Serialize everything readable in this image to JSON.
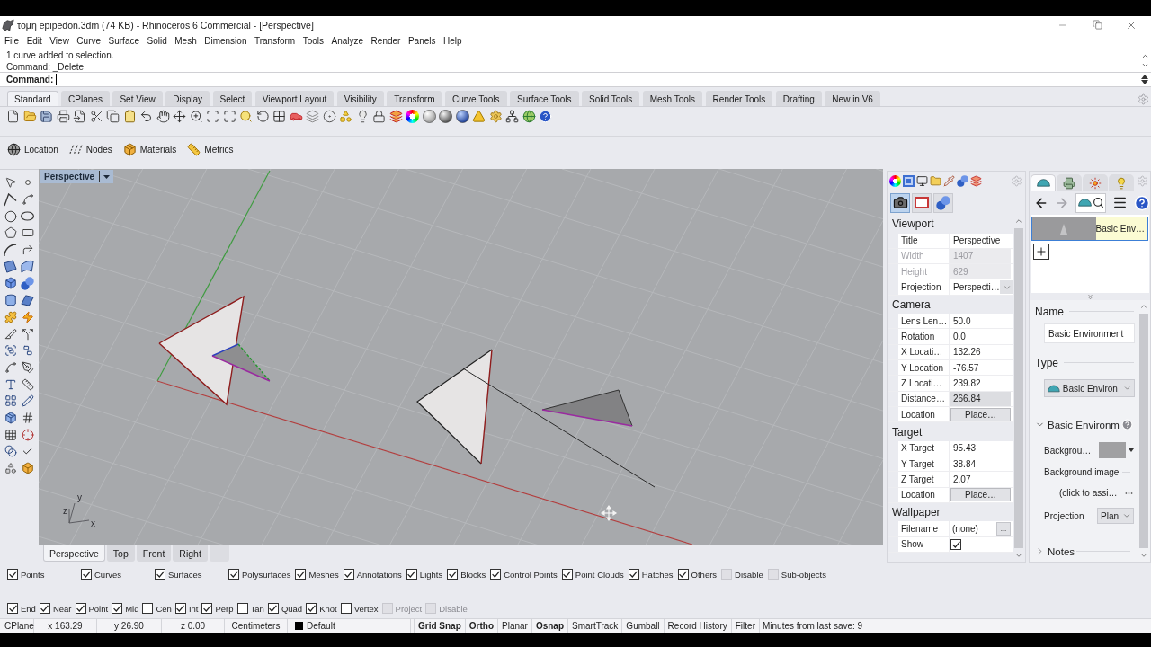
{
  "window": {
    "title": "τομη epipedon.3dm (74 KB) - Rhinoceros 6 Commercial - [Perspective]"
  },
  "menu": [
    "File",
    "Edit",
    "View",
    "Curve",
    "Surface",
    "Solid",
    "Mesh",
    "Dimension",
    "Transform",
    "Tools",
    "Analyze",
    "Render",
    "Panels",
    "Help"
  ],
  "command_history": [
    "1 curve added to selection.",
    "Command: _Delete"
  ],
  "command_line": {
    "label": "Command:"
  },
  "toolbar_tabs": [
    {
      "label": "Standard",
      "selected": true
    },
    {
      "label": "CPlanes",
      "selected": false
    },
    {
      "label": "Set View",
      "selected": false
    },
    {
      "label": "Display",
      "selected": false
    },
    {
      "label": "Select",
      "selected": false
    },
    {
      "label": "Viewport Layout",
      "selected": false
    },
    {
      "label": "Visibility",
      "selected": false
    },
    {
      "label": "Transform",
      "selected": false
    },
    {
      "label": "Curve Tools",
      "selected": false
    },
    {
      "label": "Surface Tools",
      "selected": false
    },
    {
      "label": "Solid Tools",
      "selected": false
    },
    {
      "label": "Mesh Tools",
      "selected": false
    },
    {
      "label": "Render Tools",
      "selected": false
    },
    {
      "label": "Drafting",
      "selected": false
    },
    {
      "label": "New in V6",
      "selected": false
    }
  ],
  "panel_buttons": [
    "Location",
    "Nodes",
    "Materials",
    "Metrics"
  ],
  "viewport": {
    "title": "Perspective",
    "axis_labels": [
      "y",
      "z",
      "x"
    ]
  },
  "viewport_tabs": [
    {
      "label": "Perspective",
      "selected": true
    },
    {
      "label": "Top",
      "selected": false
    },
    {
      "label": "Front",
      "selected": false
    },
    {
      "label": "Right",
      "selected": false
    }
  ],
  "properties": {
    "pages": [
      {
        "selected": true
      },
      {
        "selected": false
      },
      {
        "selected": false
      }
    ],
    "sections": [
      {
        "title": "Viewport",
        "rows": [
          {
            "label": "Title",
            "value": "Perspective",
            "kind": "text",
            "disabled": false,
            "highlighted": false
          },
          {
            "label": "Width",
            "value": "1407",
            "kind": "text",
            "disabled": true,
            "highlighted": false
          },
          {
            "label": "Height",
            "value": "629",
            "kind": "text",
            "disabled": true,
            "highlighted": false
          },
          {
            "label": "Projection",
            "value": "Perspecti…",
            "kind": "dropdown",
            "disabled": false,
            "highlighted": false
          }
        ]
      },
      {
        "title": "Camera",
        "rows": [
          {
            "label": "Lens Len…",
            "value": "50.0",
            "kind": "text",
            "disabled": false,
            "highlighted": false
          },
          {
            "label": "Rotation",
            "value": "0.0",
            "kind": "text",
            "disabled": false,
            "highlighted": false
          },
          {
            "label": "X Locati…",
            "value": "132.26",
            "kind": "text",
            "disabled": false,
            "highlighted": false
          },
          {
            "label": "Y Location",
            "value": "-76.57",
            "kind": "text",
            "disabled": false,
            "highlighted": false
          },
          {
            "label": "Z Locati…",
            "value": "239.82",
            "kind": "text",
            "disabled": false,
            "highlighted": false
          },
          {
            "label": "Distance…",
            "value": "266.84",
            "kind": "text",
            "disabled": false,
            "highlighted": true
          },
          {
            "label": "Location",
            "value": "Place…",
            "kind": "button",
            "disabled": false,
            "highlighted": false
          }
        ]
      },
      {
        "title": "Target",
        "rows": [
          {
            "label": "X Target",
            "value": "95.43",
            "kind": "text",
            "disabled": false,
            "highlighted": false
          },
          {
            "label": "Y Target",
            "value": "38.84",
            "kind": "text",
            "disabled": false,
            "highlighted": false
          },
          {
            "label": "Z Target",
            "value": "2.07",
            "kind": "text",
            "disabled": false,
            "highlighted": false
          },
          {
            "label": "Location",
            "value": "Place…",
            "kind": "button",
            "disabled": false,
            "highlighted": false
          }
        ]
      },
      {
        "title": "Wallpaper",
        "rows": [
          {
            "label": "Filename",
            "value": "(none)",
            "kind": "file",
            "button": "...",
            "disabled": false,
            "highlighted": false
          },
          {
            "label": "Show",
            "kind": "checkbox",
            "checked": true,
            "disabled": false
          }
        ]
      }
    ]
  },
  "environments": {
    "tabs": [
      {
        "selected": true
      },
      {
        "selected": false
      },
      {
        "selected": false
      },
      {
        "selected": false
      }
    ],
    "thumbnail": {
      "label": "Basic Env…",
      "selected": true
    },
    "name": {
      "label": "Name",
      "value": "Basic Environment"
    },
    "type": {
      "label": "Type",
      "value": "Basic Environ"
    },
    "settings": {
      "title": "Basic Environm",
      "expanded": true,
      "background_label": "Backgrou…",
      "image_label": "Background image",
      "image_value": "(click to assi…",
      "projection_label": "Projection",
      "projection_value": "Plan"
    },
    "notes": {
      "title": "Notes",
      "expanded": false
    }
  },
  "object_filters": [
    {
      "label": "Points",
      "checked": true,
      "disabled": false
    },
    {
      "label": "Curves",
      "checked": true,
      "disabled": false
    },
    {
      "label": "Surfaces",
      "checked": true,
      "disabled": false
    },
    {
      "label": "Polysurfaces",
      "checked": true,
      "disabled": false
    },
    {
      "label": "Meshes",
      "checked": true,
      "disabled": false
    },
    {
      "label": "Annotations",
      "checked": true,
      "disabled": false
    },
    {
      "label": "Lights",
      "checked": true,
      "disabled": false
    },
    {
      "label": "Blocks",
      "checked": true,
      "disabled": false
    },
    {
      "label": "Control Points",
      "checked": true,
      "disabled": false
    },
    {
      "label": "Point Clouds",
      "checked": true,
      "disabled": false
    },
    {
      "label": "Hatches",
      "checked": true,
      "disabled": false
    },
    {
      "label": "Others",
      "checked": true,
      "disabled": false
    },
    {
      "label": "Disable",
      "checked": false,
      "disabled": true
    },
    {
      "label": "Sub-objects",
      "checked": false,
      "disabled": true
    }
  ],
  "osnaps": [
    {
      "label": "End",
      "checked": true,
      "disabled": false
    },
    {
      "label": "Near",
      "checked": true,
      "disabled": false
    },
    {
      "label": "Point",
      "checked": true,
      "disabled": false
    },
    {
      "label": "Mid",
      "checked": true,
      "disabled": false
    },
    {
      "label": "Cen",
      "checked": false,
      "disabled": false
    },
    {
      "label": "Int",
      "checked": true,
      "disabled": false
    },
    {
      "label": "Perp",
      "checked": true,
      "disabled": false
    },
    {
      "label": "Tan",
      "checked": false,
      "disabled": false
    },
    {
      "label": "Quad",
      "checked": true,
      "disabled": false
    },
    {
      "label": "Knot",
      "checked": true,
      "disabled": false
    },
    {
      "label": "Vertex",
      "checked": false,
      "disabled": false
    },
    {
      "label": "Project",
      "checked": false,
      "disabled": true
    },
    {
      "label": "Disable",
      "checked": false,
      "disabled": true
    }
  ],
  "status_bar": {
    "cplane": "CPlane",
    "x": "x 163.29",
    "y": "y 26.90",
    "z": "z 0.00",
    "units": "Centimeters",
    "layer": "Default",
    "toggles": [
      {
        "label": "Grid Snap",
        "on": true
      },
      {
        "label": "Ortho",
        "on": true
      },
      {
        "label": "Planar",
        "on": false
      },
      {
        "label": "Osnap",
        "on": true
      },
      {
        "label": "SmartTrack",
        "on": false
      },
      {
        "label": "Gumball",
        "on": false
      },
      {
        "label": "Record History",
        "on": false
      },
      {
        "label": "Filter",
        "on": false
      }
    ],
    "message": "Minutes from last save: 9"
  }
}
